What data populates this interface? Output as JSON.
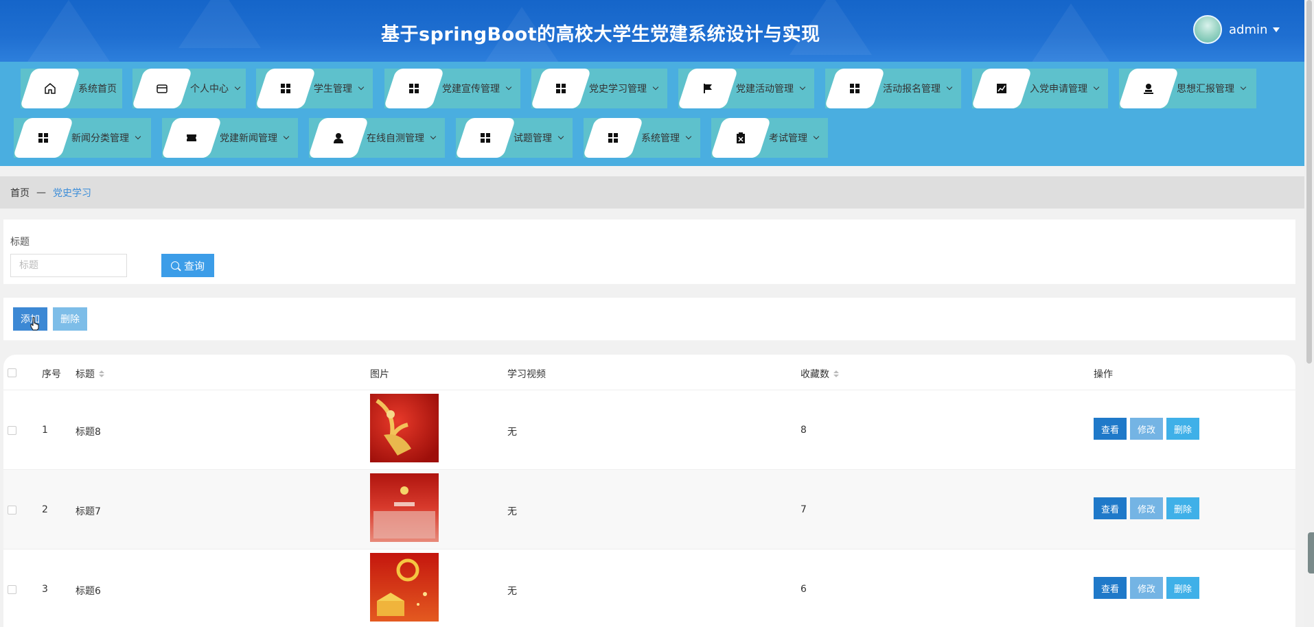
{
  "header": {
    "title": "基于springBoot的高校大学生党建系统设计与实现",
    "user": {
      "name": "admin",
      "avatar_icon": "avatar"
    },
    "colors": {
      "header_bg": "#1f6fd1",
      "nav_bg": "#4aaee0",
      "nav_item_bg": "#5ec1cc"
    }
  },
  "nav": {
    "items": [
      {
        "label": "系统首页",
        "icon": "home-icon",
        "has_dropdown": false
      },
      {
        "label": "个人中心",
        "icon": "wallet-icon",
        "has_dropdown": true
      },
      {
        "label": "学生管理",
        "icon": "grid-icon",
        "has_dropdown": true
      },
      {
        "label": "党建宣传管理",
        "icon": "grid-icon",
        "has_dropdown": true
      },
      {
        "label": "党史学习管理",
        "icon": "grid-icon",
        "has_dropdown": true
      },
      {
        "label": "党建活动管理",
        "icon": "flag-icon",
        "has_dropdown": true
      },
      {
        "label": "活动报名管理",
        "icon": "grid-icon",
        "has_dropdown": true
      },
      {
        "label": "入党申请管理",
        "icon": "chart-icon",
        "has_dropdown": true
      },
      {
        "label": "思想汇报管理",
        "icon": "stamp-icon",
        "has_dropdown": true
      },
      {
        "label": "新闻分类管理",
        "icon": "grid-icon",
        "has_dropdown": true
      },
      {
        "label": "党建新闻管理",
        "icon": "ticket-icon",
        "has_dropdown": true
      },
      {
        "label": "在线自测管理",
        "icon": "person-icon",
        "has_dropdown": true
      },
      {
        "label": "试题管理",
        "icon": "grid-icon",
        "has_dropdown": true
      },
      {
        "label": "系统管理",
        "icon": "grid-icon",
        "has_dropdown": true
      },
      {
        "label": "考试管理",
        "icon": "clipboard-icon",
        "has_dropdown": true
      }
    ]
  },
  "breadcrumb": {
    "home": "首页",
    "separator": "—",
    "current": "党史学习"
  },
  "search": {
    "label": "标题",
    "placeholder": "标题",
    "value": "",
    "button_label": "查询"
  },
  "actions": {
    "add_label": "添加",
    "delete_label": "删除"
  },
  "table": {
    "headers": {
      "index": "序号",
      "title": "标题",
      "image": "图片",
      "video": "学习视频",
      "favorites": "收藏数",
      "ops": "操作"
    },
    "rows": [
      {
        "index": "1",
        "title": "标题8",
        "video": "无",
        "favorites": "8"
      },
      {
        "index": "2",
        "title": "标题7",
        "video": "无",
        "favorites": "7"
      },
      {
        "index": "3",
        "title": "标题6",
        "video": "无",
        "favorites": "6"
      }
    ],
    "row_actions": {
      "view": "查看",
      "edit": "修改",
      "delete": "删除"
    }
  }
}
